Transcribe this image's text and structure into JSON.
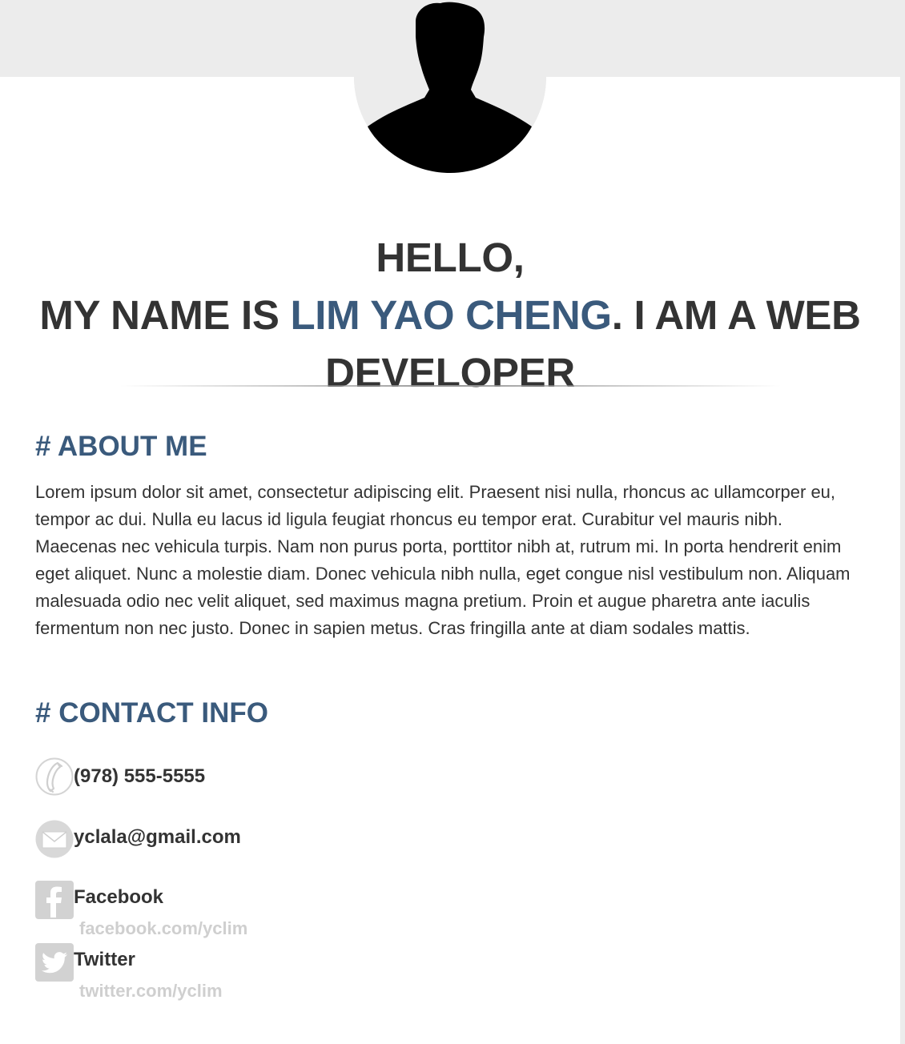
{
  "profile": {
    "avatar_icon": "person-silhouette-icon"
  },
  "headline": {
    "line1": "HELLO,",
    "prefix": "MY NAME IS ",
    "name": "LIM YAO CHENG",
    "suffix_a": ". I AM A WEB",
    "suffix_b": "DEVELOPER"
  },
  "about": {
    "title": "# ABOUT ME",
    "text": "Lorem ipsum dolor sit amet, consectetur adipiscing elit. Praesent nisi nulla, rhoncus ac ullamcorper eu, tempor ac dui. Nulla eu lacus id ligula feugiat rhoncus eu tempor erat. Curabitur vel mauris nibh. Maecenas nec vehicula turpis. Nam non purus porta, porttitor nibh at, rutrum mi. In porta hendrerit enim eget aliquet. Nunc a molestie diam. Donec vehicula nibh nulla, eget congue nisl vestibulum non. Aliquam malesuada odio nec velit aliquet, sed maximus magna pretium. Proin et augue pharetra ante iaculis fermentum non nec justo. Donec in sapien metus. Cras fringilla ante at diam sodales mattis."
  },
  "contact": {
    "title": "# CONTACT INFO",
    "phone": {
      "icon": "phone-icon",
      "label": "(978) 555-5555"
    },
    "email": {
      "icon": "mail-icon",
      "label": "yclala@gmail.com"
    },
    "facebook": {
      "icon": "facebook-icon",
      "label": "Facebook",
      "link": "facebook.com/yclim"
    },
    "twitter": {
      "icon": "twitter-icon",
      "label": "Twitter",
      "link": "twitter.com/yclim"
    }
  },
  "colors": {
    "accent": "#3a5a7c",
    "text": "#333333",
    "muted": "#cfcfcf",
    "background": "#ececec"
  }
}
